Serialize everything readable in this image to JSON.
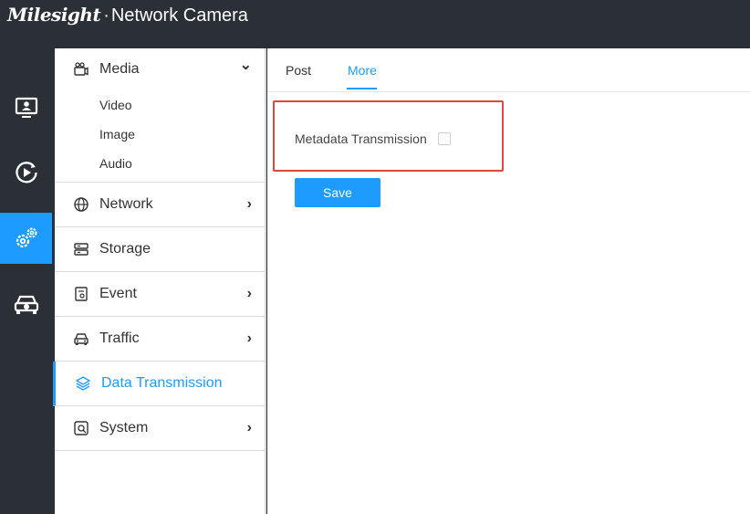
{
  "header": {
    "logo_text": "Milesight",
    "separator": "·",
    "product_name": "Network Camera"
  },
  "icon_rail": [
    {
      "icon": "live-view-monitor-icon",
      "active": false
    },
    {
      "icon": "playback-icon",
      "active": false
    },
    {
      "icon": "settings-gears-icon",
      "active": true
    },
    {
      "icon": "traffic-vehicle-icon",
      "active": false
    }
  ],
  "sidebar": {
    "media": {
      "label": "Media",
      "chevron": "⌄",
      "subitems": [
        "Video",
        "Image",
        "Audio"
      ]
    },
    "items": [
      {
        "label": "Network",
        "chevron": "›"
      },
      {
        "label": "Storage",
        "chevron": ""
      },
      {
        "label": "Event",
        "chevron": "›"
      },
      {
        "label": "Traffic",
        "chevron": "›"
      },
      {
        "label": "Data Transmission",
        "chevron": "",
        "active": true
      },
      {
        "label": "System",
        "chevron": "›"
      }
    ]
  },
  "tabs": [
    {
      "label": "Post",
      "active": false
    },
    {
      "label": "More",
      "active": true
    }
  ],
  "form": {
    "metadata_label": "Metadata Transmission",
    "metadata_checked": false,
    "save_label": "Save"
  },
  "colors": {
    "accent": "#1e9bff",
    "dark_bg": "#2b2f36",
    "highlight_border": "#e0473d"
  }
}
